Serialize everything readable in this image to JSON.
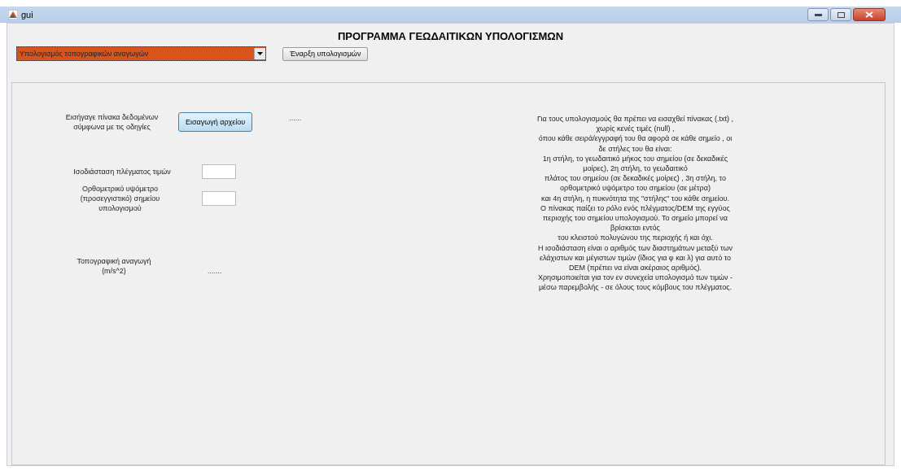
{
  "window": {
    "title": "gui"
  },
  "heading": "ΠΡΟΓΡΑΜΜΑ ΓΕΩΔΑΙΤΙΚΩΝ ΥΠΟΛΟΓΙΣΜΩΝ",
  "dropdown": {
    "value": "Υπολογισμός τοπογραφικών αναγωγών"
  },
  "start_button": "Έναρξη υπολογισμών",
  "import": {
    "label_lines": [
      "Εισήγαγε πίνακα δεδομένων",
      "σύμφωνα με τις οδηγίες"
    ],
    "button": "Εισαγωγή αρχείου",
    "status": "......"
  },
  "fields": [
    {
      "label_lines": [
        "Ισοδιάσταση πλέγματος τιμών"
      ]
    },
    {
      "label_lines": [
        "Ορθομετρικό υψόμετρο",
        "(προσεγγιστικό) σημείου",
        "υπολογισμού"
      ]
    }
  ],
  "result": {
    "label_lines": [
      "Τοπογραφική αναγωγή",
      "(m/s^2)"
    ],
    "value": "......."
  },
  "help_lines": [
    "Για τους υπολογισμούς θα πρέπει να εισαχθεί πίνακας (.txt) ,",
    "χωρίς κενές τιμές (null) ,",
    "όπου κάθε σειρά/εγγραφή του θα αφορά σε κάθε σημείο , οι",
    "δε στήλες του θα είναι:",
    "1η στήλη, το γεωδαιτικό μήκος του σημείου (σε δεκαδικές",
    "μοίρες), 2η στήλη, το γεωδαιτικό",
    "πλάτος του σημείου (σε δεκαδικές μοίρες) , 3η στήλη, το",
    "ορθομετρικό υψόμετρο του σημείου (σε μέτρα)",
    "και 4η στήλη, η πυκνότητα της \"στήλης\" του κάθε σημείου.",
    "Ο πίνακας παίζει το ρόλο ενός πλέγματος/DEM της εγγύος",
    "περιοχής του σημείου υπολογισμού. Το σημείο μπορεί να",
    "βρίσκεται εντός",
    "του κλειστού πολυγώνου της περιοχής ή και όχι.",
    "Η ισοδιάσταση είναι ο αριθμός  των διαστημάτων μεταξύ των",
    "ελάχιστων και μέγιστων τιμών (ίδιος για φ και λ)  για αυτό το",
    "DEM (πρέπει να είναι ακέραιος αριθμός).",
    "Χρησιμοποιείται για τον εν συνεχεία υπολογισμό των τιμών -",
    "μέσω παρεμβολής - σε όλους τους κόμβους του πλέγματος."
  ]
}
